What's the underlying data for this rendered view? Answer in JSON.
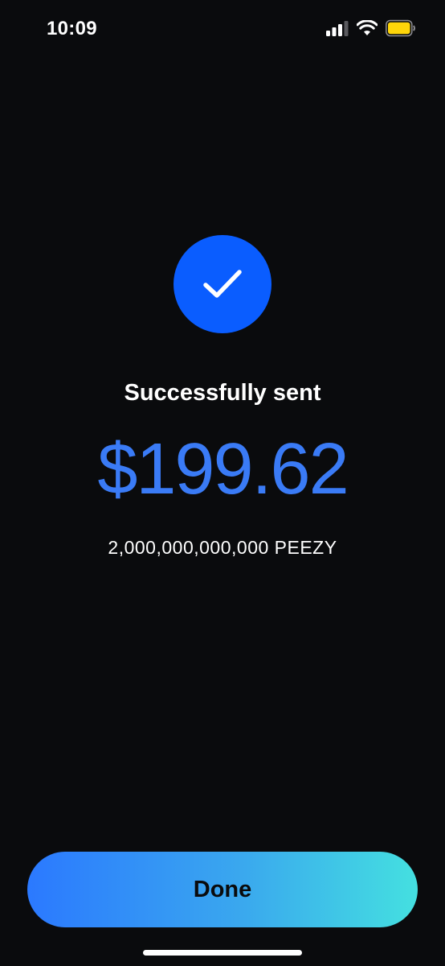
{
  "status_bar": {
    "time": "10:09",
    "icons": [
      "signal-icon",
      "wifi-icon",
      "battery-icon"
    ],
    "battery_color": "#ffd60a"
  },
  "confirmation": {
    "icon": "checkmark-icon",
    "icon_bg_color": "#0a5dff",
    "headline": "Successfully sent",
    "fiat_amount": "$199.62",
    "token_amount": "2,000,000,000,000 PEEZY"
  },
  "actions": {
    "done_label": "Done"
  },
  "colors": {
    "background": "#0a0b0d",
    "amount": "#3a7bf6",
    "button_gradient_start": "#2b79ff",
    "button_gradient_end": "#44e0e0"
  }
}
